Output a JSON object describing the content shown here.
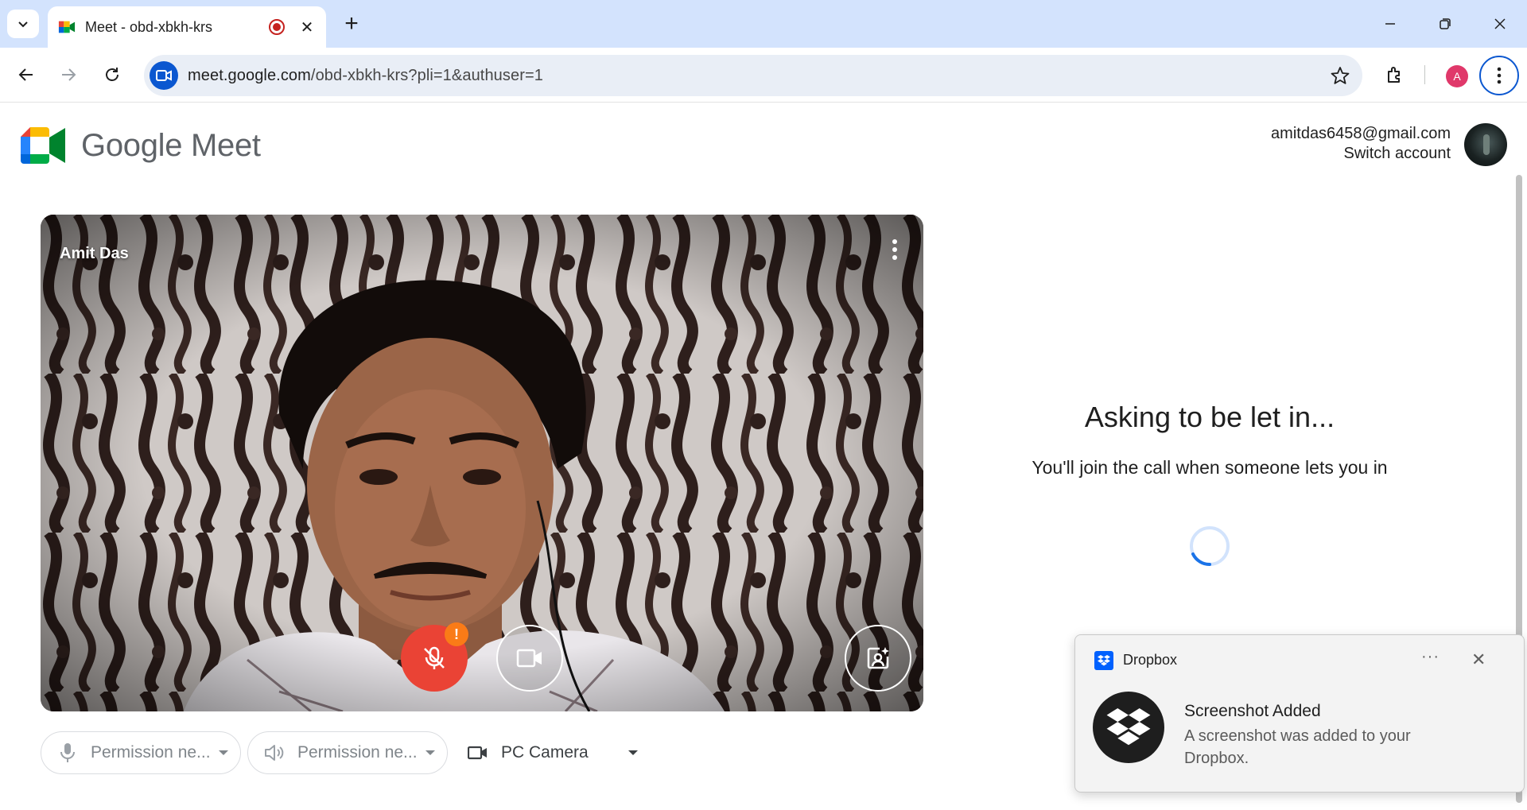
{
  "browser": {
    "tab_title": "Meet - obd-xbkh-krs",
    "url_host": "meet.google.com",
    "url_path": "/obd-xbkh-krs?pli=1&authuser=1",
    "profile_initial": "A"
  },
  "header": {
    "logo_word1": "Google",
    "logo_word2": "Meet",
    "account_email": "amitdas6458@gmail.com",
    "switch_account": "Switch account"
  },
  "video": {
    "participant_name": "Amit Das",
    "warning_badge": "!"
  },
  "devices": {
    "mic_label": "Permission ne...",
    "speaker_label": "Permission ne...",
    "camera_label": "PC Camera"
  },
  "status": {
    "title": "Asking to be let in...",
    "subtitle": "You'll join the call when someone lets you in"
  },
  "toast": {
    "app_name": "Dropbox",
    "more": "···",
    "close": "✕",
    "title": "Screenshot Added",
    "body": "A screenshot was added to your Dropbox."
  },
  "colors": {
    "tabstrip": "#d3e3fd",
    "accent_blue": "#0b57d0",
    "mic_off_red": "#ea4335",
    "warning_orange": "#fa7b17",
    "dropbox_blue": "#0061fe"
  }
}
